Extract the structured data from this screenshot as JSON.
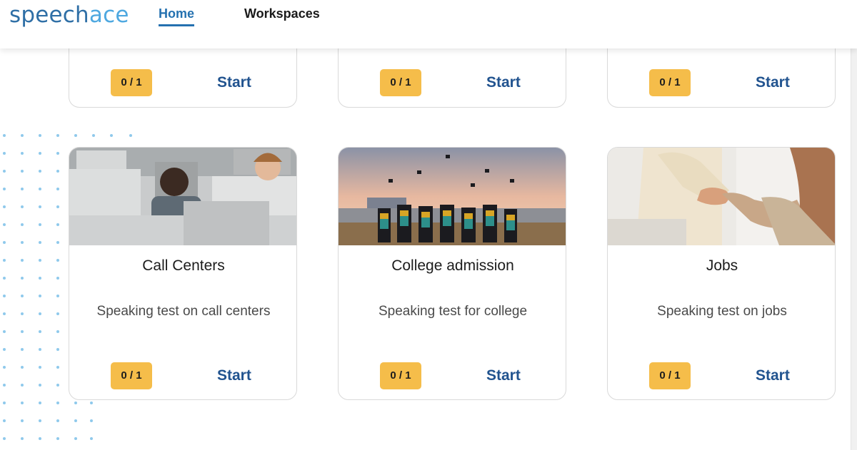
{
  "header": {
    "logo_part1": "speech",
    "logo_part2": "ace",
    "nav": {
      "home": "Home",
      "workspaces": "Workspaces"
    }
  },
  "top_cards": [
    {
      "score": "0 / 1",
      "action": "Start"
    },
    {
      "score": "0 / 1",
      "action": "Start"
    },
    {
      "score": "0 / 1",
      "action": "Start"
    }
  ],
  "cards": [
    {
      "title": "Call Centers",
      "description": "Speaking test on call centers",
      "score": "0 / 1",
      "action": "Start",
      "image": "call-center-photo"
    },
    {
      "title": "College admission",
      "description": "Speaking test for college",
      "score": "0 / 1",
      "action": "Start",
      "image": "graduation-photo"
    },
    {
      "title": "Jobs",
      "description": "Speaking test on jobs",
      "score": "0 / 1",
      "action": "Start",
      "image": "handshake-photo"
    }
  ],
  "colors": {
    "brand_dark": "#2f6fa6",
    "brand_light": "#4ea8e0",
    "badge": "#f5bd4a",
    "start": "#21538f",
    "dots": "#8fc9ec"
  }
}
